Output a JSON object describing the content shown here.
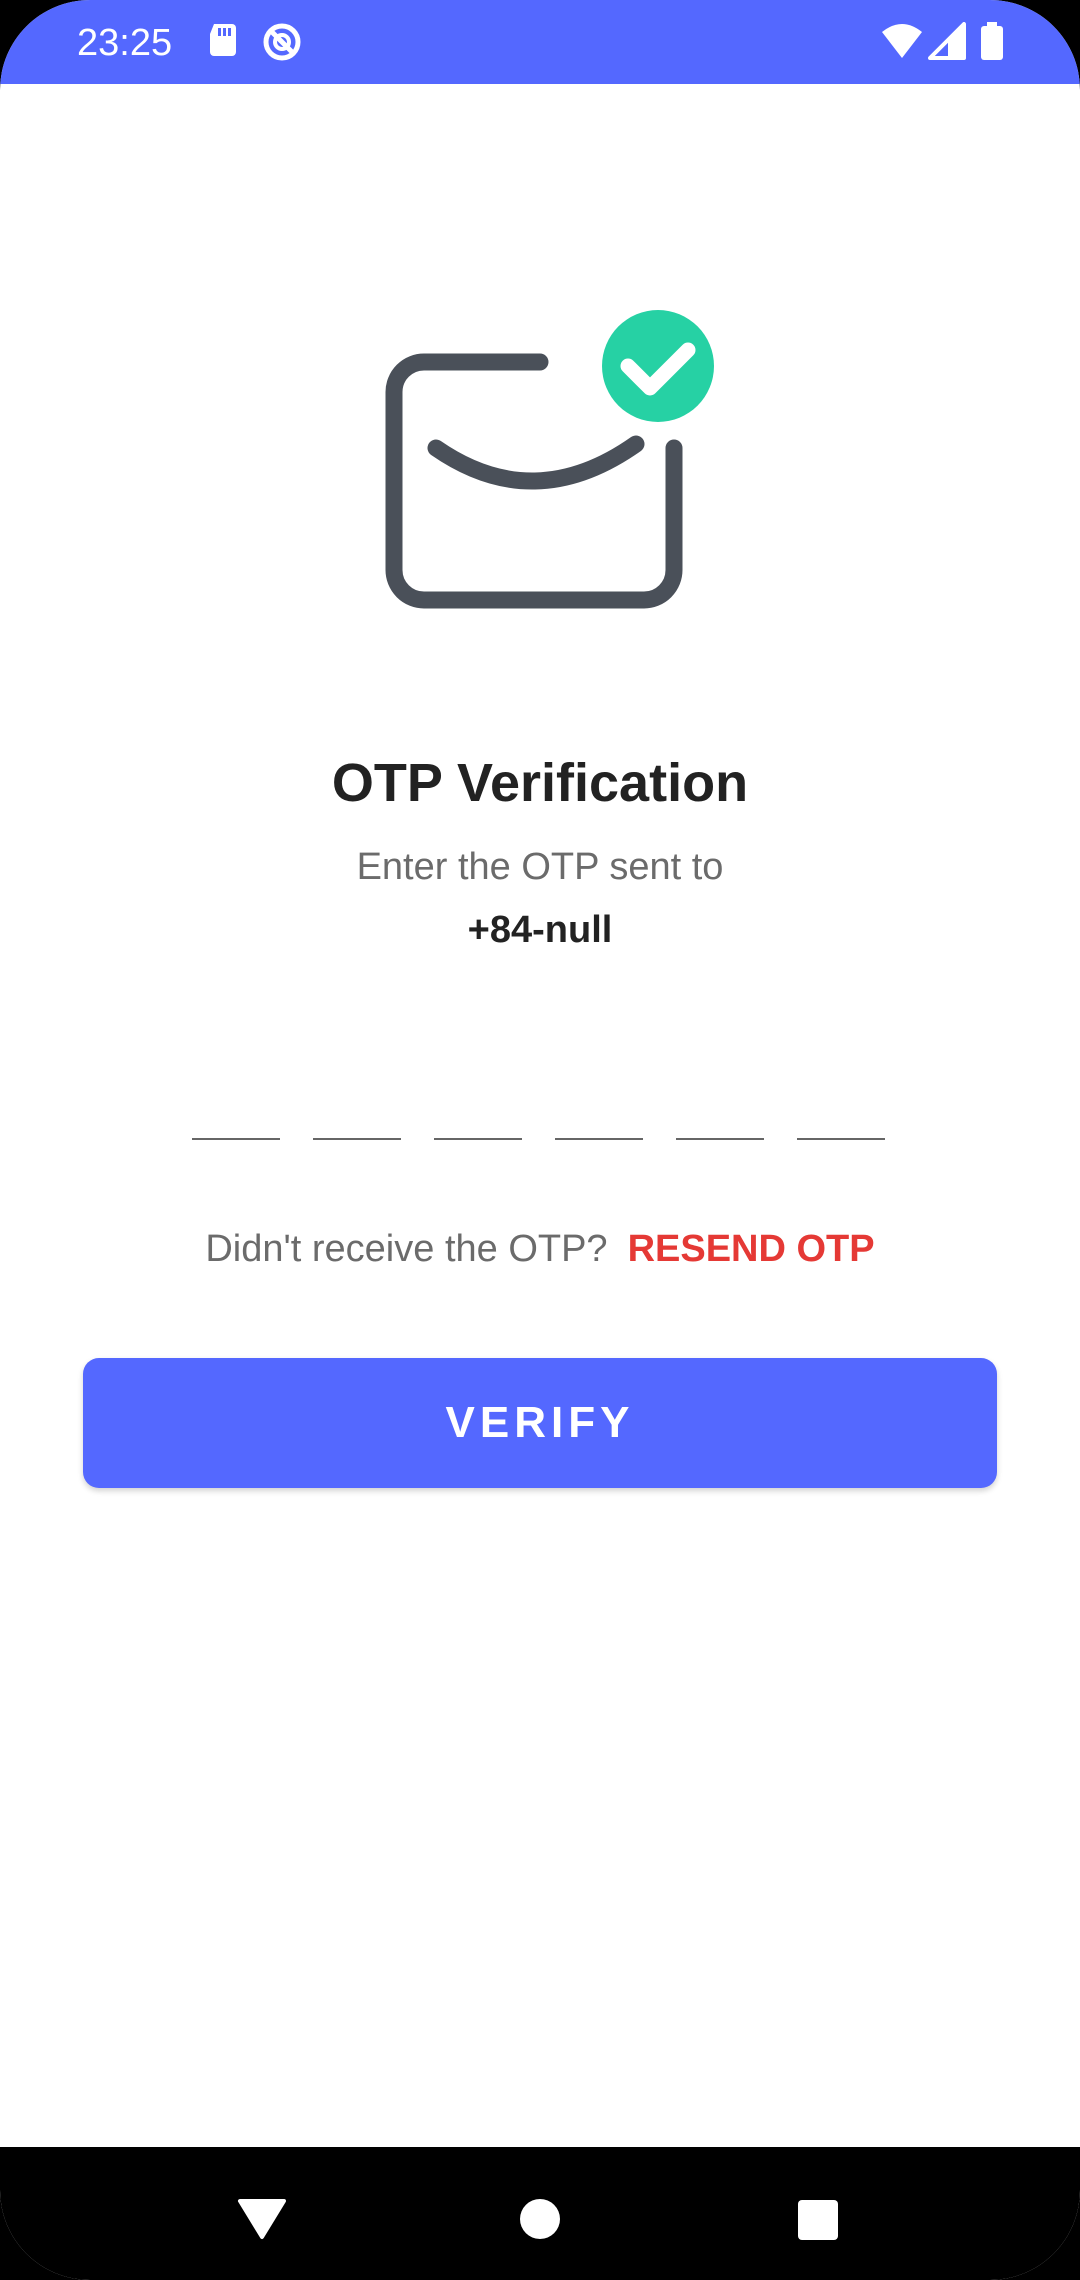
{
  "status_bar": {
    "time": "23:25",
    "icons": [
      "sd-card-icon",
      "sync-icon",
      "wifi-icon",
      "signal-icon",
      "battery-icon"
    ],
    "background": "#5468ff"
  },
  "illustration": {
    "icon": "envelope-check-icon",
    "envelope_color": "#4a5059",
    "check_color": "#26d1a4"
  },
  "otp": {
    "title": "OTP Verification",
    "subtitle": "Enter the OTP sent to",
    "phone": "+84-null",
    "digits": [
      "",
      "",
      "",
      "",
      "",
      ""
    ],
    "resend_prompt": "Didn't receive the OTP?",
    "resend_label": "RESEND OTP",
    "verify_label": "VERIFY"
  },
  "colors": {
    "accent": "#5468ff",
    "resend": "#e53935",
    "title": "#222222",
    "muted": "#6b6b6b"
  },
  "nav_bar": {
    "buttons": [
      "back-icon",
      "home-icon",
      "recents-icon"
    ]
  }
}
